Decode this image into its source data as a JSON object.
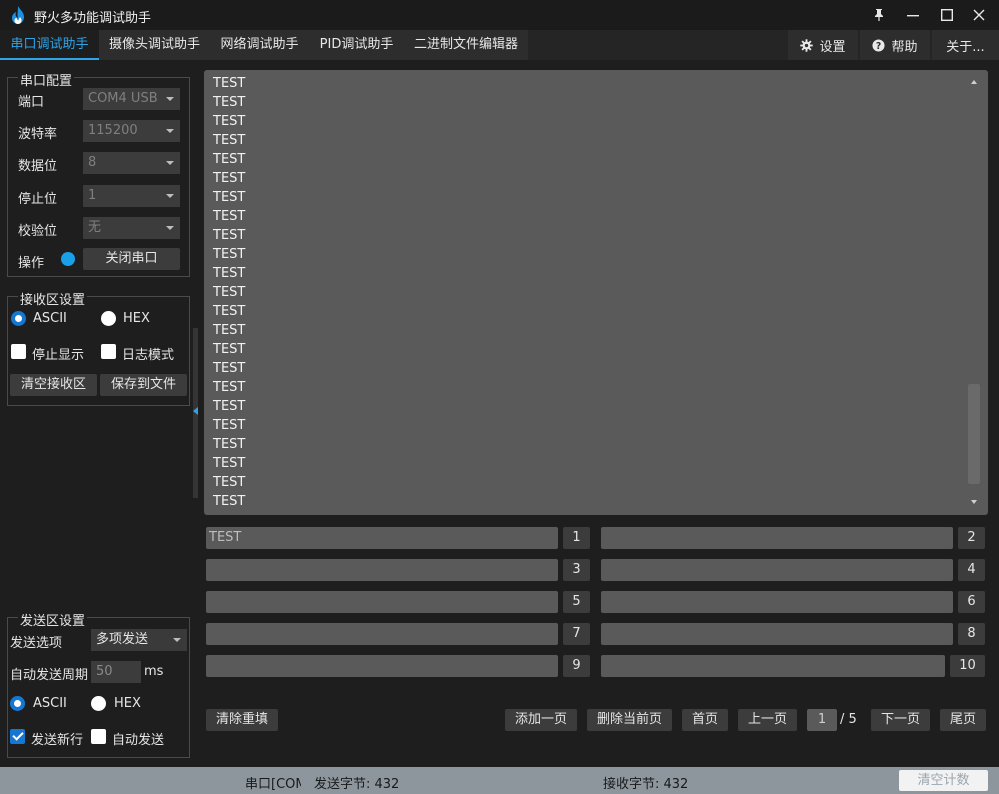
{
  "title": "野火多功能调试助手",
  "tabs": [
    "串口调试助手",
    "摄像头调试助手",
    "网络调试助手",
    "PID调试助手",
    "二进制文件编辑器"
  ],
  "right_tabs": {
    "settings": "设置",
    "help": "帮助",
    "about": "关于..."
  },
  "serial_config": {
    "title": "串口配置",
    "port_label": "端口",
    "port_value": "COM4 USB",
    "baud_label": "波特率",
    "baud_value": "115200",
    "databits_label": "数据位",
    "databits_value": "8",
    "stopbits_label": "停止位",
    "stopbits_value": "1",
    "parity_label": "校验位",
    "parity_value": "无",
    "op_label": "操作",
    "close_port": "关闭串口"
  },
  "recv_settings": {
    "title": "接收区设置",
    "ascii": "ASCII",
    "hex": "HEX",
    "stop_display": "停止显示",
    "log_mode": "日志模式",
    "clear_recv": "清空接收区",
    "save_file": "保存到文件"
  },
  "send_settings": {
    "title": "发送区设置",
    "option_label": "发送选项",
    "option_value": "多项发送",
    "period_label": "自动发送周期",
    "period_value": "50",
    "period_unit": "ms",
    "ascii": "ASCII",
    "hex": "HEX",
    "send_newline": "发送新行",
    "auto_send": "自动发送"
  },
  "receive_lines": [
    "TEST",
    "TEST",
    "TEST",
    "TEST",
    "TEST",
    "TEST",
    "TEST",
    "TEST",
    "TEST",
    "TEST",
    "TEST",
    "TEST",
    "TEST",
    "TEST",
    "TEST",
    "TEST",
    "TEST",
    "TEST",
    "TEST",
    "TEST",
    "TEST",
    "TEST",
    "TEST"
  ],
  "send_items": [
    {
      "text": "TEST",
      "num": "1"
    },
    {
      "text": "",
      "num": "2"
    },
    {
      "text": "",
      "num": "3"
    },
    {
      "text": "",
      "num": "4"
    },
    {
      "text": "",
      "num": "5"
    },
    {
      "text": "",
      "num": "6"
    },
    {
      "text": "",
      "num": "7"
    },
    {
      "text": "",
      "num": "8"
    },
    {
      "text": "",
      "num": "9"
    },
    {
      "text": "",
      "num": "10"
    }
  ],
  "bottom": {
    "clear_refill": "清除重填",
    "add_page": "添加一页",
    "delete_page": "删除当前页",
    "first_page": "首页",
    "prev_page": "上一页",
    "page": "1",
    "total": "/ 5",
    "next_page": "下一页",
    "last_page": "尾页"
  },
  "status": {
    "port": "串口[COM",
    "sent": "发送字节: 432",
    "received": "接收字节: 432",
    "clear_count": "清空计数"
  },
  "colors": {
    "accent": "#2ea3e8",
    "bg": "#1e1e1e",
    "status_bg": "#8c969c"
  }
}
